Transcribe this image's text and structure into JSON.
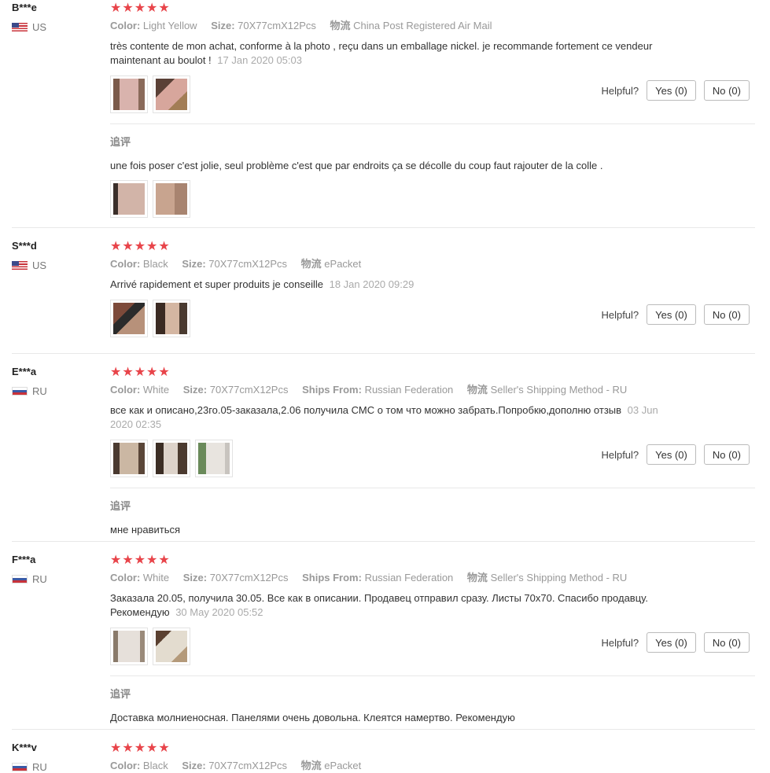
{
  "labels": {
    "color": "Color:",
    "size": "Size:",
    "logistics": "物流",
    "ships_from": "Ships From:",
    "helpful": "Helpful?",
    "followup": "追评"
  },
  "rating_stars": "★★★★★",
  "reviews": [
    {
      "name": "B***e",
      "country": "US",
      "color": "Light Yellow",
      "size": "70X77cmX12Pcs",
      "logistics": "China Post Registered Air Mail",
      "text": "très contente de mon achat, conforme à la photo , reçu dans un emballage nickel. je recommande fortement ce vendeur maintenant au boulot !",
      "date": "17 Jan 2020 05:03",
      "yes": "Yes (0)",
      "no": "No (0)",
      "followup_text": "une fois poser c'est jolie, seul problème c'est que par endroits ça se décolle du coup faut rajouter de la colle ."
    },
    {
      "name": "S***d",
      "country": "US",
      "color": "Black",
      "size": "70X77cmX12Pcs",
      "logistics": "ePacket",
      "text": "Arrivé rapidement et super produits je conseille",
      "date": "18 Jan 2020 09:29",
      "yes": "Yes (0)",
      "no": "No (0)"
    },
    {
      "name": "E***a",
      "country": "RU",
      "color": "White",
      "size": "70X77cmX12Pcs",
      "ships_from": "Russian Federation",
      "logistics": "Seller's Shipping Method - RU",
      "text": "все как и описано,23го.05-заказала,2.06 получила СМС о том что можно забрать.Попробкю,дополню отзыв",
      "date": "03 Jun 2020 02:35",
      "yes": "Yes (0)",
      "no": "No (0)",
      "followup_text": "мне нравиться"
    },
    {
      "name": "F***a",
      "country": "RU",
      "color": "White",
      "size": "70X77cmX12Pcs",
      "ships_from": "Russian Federation",
      "logistics": "Seller's Shipping Method - RU",
      "text": "Заказала 20.05, получила 30.05. Все как в описании. Продавец отправил сразу. Листы 70х70. Спасибо продавцу. Рекомендую",
      "date": "30 May 2020 05:52",
      "yes": "Yes (0)",
      "no": "No (0)",
      "followup_text": "Доставка молниеносная. Панелями очень довольна. Клеятся намертво. Рекомендую"
    },
    {
      "name": "K***v",
      "country": "RU",
      "color": "Black",
      "size": "70X77cmX12Pcs",
      "logistics": "ePacket"
    }
  ]
}
